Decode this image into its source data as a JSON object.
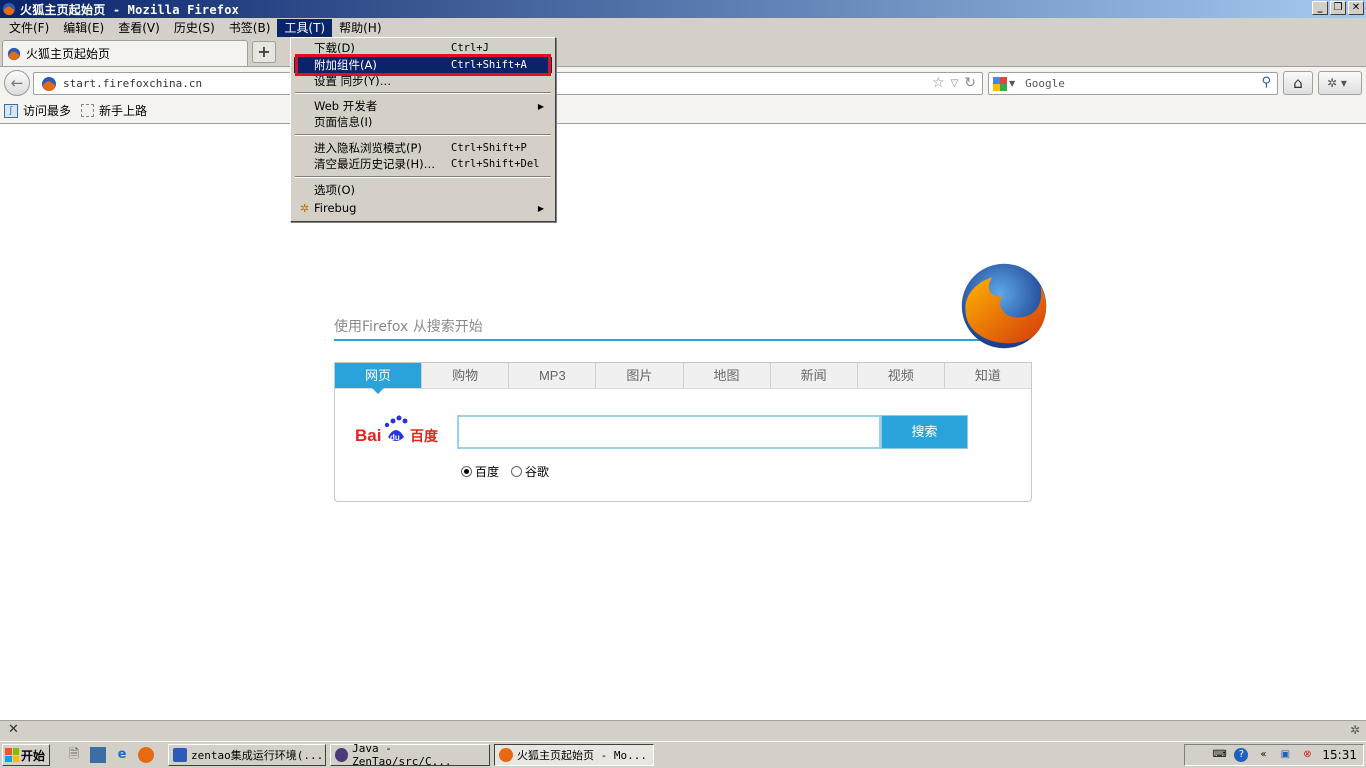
{
  "window": {
    "title": "火狐主页起始页 - Mozilla Firefox",
    "buttons": [
      "_",
      "❐",
      "✕"
    ]
  },
  "menubar": [
    {
      "label": "文件(F)"
    },
    {
      "label": "编辑(E)"
    },
    {
      "label": "查看(V)"
    },
    {
      "label": "历史(S)"
    },
    {
      "label": "书签(B)"
    },
    {
      "label": "工具(T)"
    },
    {
      "label": "帮助(H)"
    }
  ],
  "tab": {
    "label": "火狐主页起始页",
    "new_tab": "+"
  },
  "navbar": {
    "url": "start.firefoxchina.cn",
    "search_placeholder": "Google"
  },
  "bookmarks": [
    {
      "label": "访问最多"
    },
    {
      "label": "新手上路"
    }
  ],
  "tools_menu": {
    "items": [
      {
        "label": "下载(D)",
        "shortcut": "Ctrl+J"
      },
      {
        "label": "附加组件(A)",
        "shortcut": "Ctrl+Shift+A"
      },
      {
        "label": "设置 同步(Y)…",
        "shortcut": ""
      },
      {
        "label": "Web 开发者",
        "shortcut": ""
      },
      {
        "label": "页面信息(I)",
        "shortcut": ""
      },
      {
        "label": "进入隐私浏览模式(P)",
        "shortcut": "Ctrl+Shift+P"
      },
      {
        "label": "清空最近历史记录(H)…",
        "shortcut": "Ctrl+Shift+Del"
      },
      {
        "label": "选项(O)",
        "shortcut": ""
      },
      {
        "label": "Firebug",
        "shortcut": ""
      }
    ]
  },
  "page": {
    "slogan": "使用Firefox 从搜索开始",
    "search_tabs": [
      "网页",
      "购物",
      "MP3",
      "图片",
      "地图",
      "新闻",
      "视频",
      "知道"
    ],
    "baidu_logo": "Bai du 百度",
    "search_button": "搜索",
    "engines": [
      "百度",
      "谷歌"
    ]
  },
  "taskbar": {
    "start": "开始",
    "tasks": [
      {
        "label": "zentao集成运行环境(..."
      },
      {
        "label": "Java - ZenTao/src/C..."
      },
      {
        "label": "火狐主页起始页 - Mo..."
      }
    ],
    "clock": "15:31"
  },
  "colors": {
    "menu_highlight": "#0a246a",
    "accent": "#2aa3db",
    "red_outline": "#e01020"
  }
}
